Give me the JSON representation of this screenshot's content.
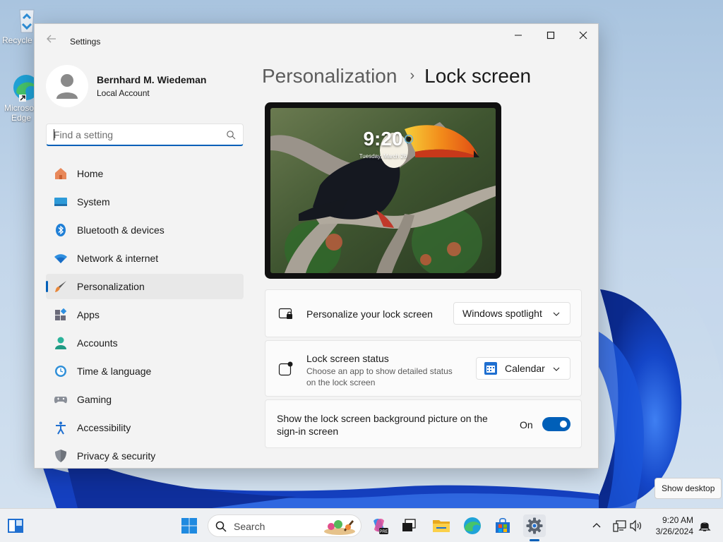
{
  "desktop": {
    "icons": [
      {
        "label": "Recycle Bin"
      },
      {
        "label": "Microsoft Edge"
      }
    ]
  },
  "window": {
    "title": "Settings",
    "controls": {
      "minimize": "minimize-icon",
      "maximize": "maximize-icon",
      "close": "close-icon"
    }
  },
  "profile": {
    "name": "Bernhard M. Wiedeman",
    "account_type": "Local Account"
  },
  "search": {
    "placeholder": "Find a setting",
    "value": ""
  },
  "nav": {
    "items": [
      {
        "label": "Home",
        "icon": "home-icon"
      },
      {
        "label": "System",
        "icon": "system-icon"
      },
      {
        "label": "Bluetooth & devices",
        "icon": "bluetooth-icon"
      },
      {
        "label": "Network & internet",
        "icon": "wifi-icon"
      },
      {
        "label": "Personalization",
        "icon": "brush-icon",
        "active": true
      },
      {
        "label": "Apps",
        "icon": "apps-icon"
      },
      {
        "label": "Accounts",
        "icon": "person-icon"
      },
      {
        "label": "Time & language",
        "icon": "globe-clock-icon"
      },
      {
        "label": "Gaming",
        "icon": "gamepad-icon"
      },
      {
        "label": "Accessibility",
        "icon": "accessibility-icon"
      },
      {
        "label": "Privacy & security",
        "icon": "shield-icon"
      }
    ]
  },
  "page": {
    "parent": "Personalization",
    "separator": "›",
    "current": "Lock screen"
  },
  "preview": {
    "time": "9:20",
    "date": "Tuesday, March 26"
  },
  "settings": {
    "personalize": {
      "title": "Personalize your lock screen",
      "value": "Windows spotlight"
    },
    "status": {
      "title": "Lock screen status",
      "description_line1": "Choose an app to show detailed status",
      "description_line2": "on the lock screen",
      "value": "Calendar"
    },
    "signin_background": {
      "title_line1": "Show the lock screen background picture on the",
      "title_line2": "sign-in screen",
      "state_label": "On",
      "enabled": true
    }
  },
  "tooltip": {
    "text": "Show desktop"
  },
  "taskbar": {
    "search_label": "Search",
    "clock_time": "9:20 AM",
    "clock_date": "3/26/2024",
    "accent": "#005fb8"
  }
}
